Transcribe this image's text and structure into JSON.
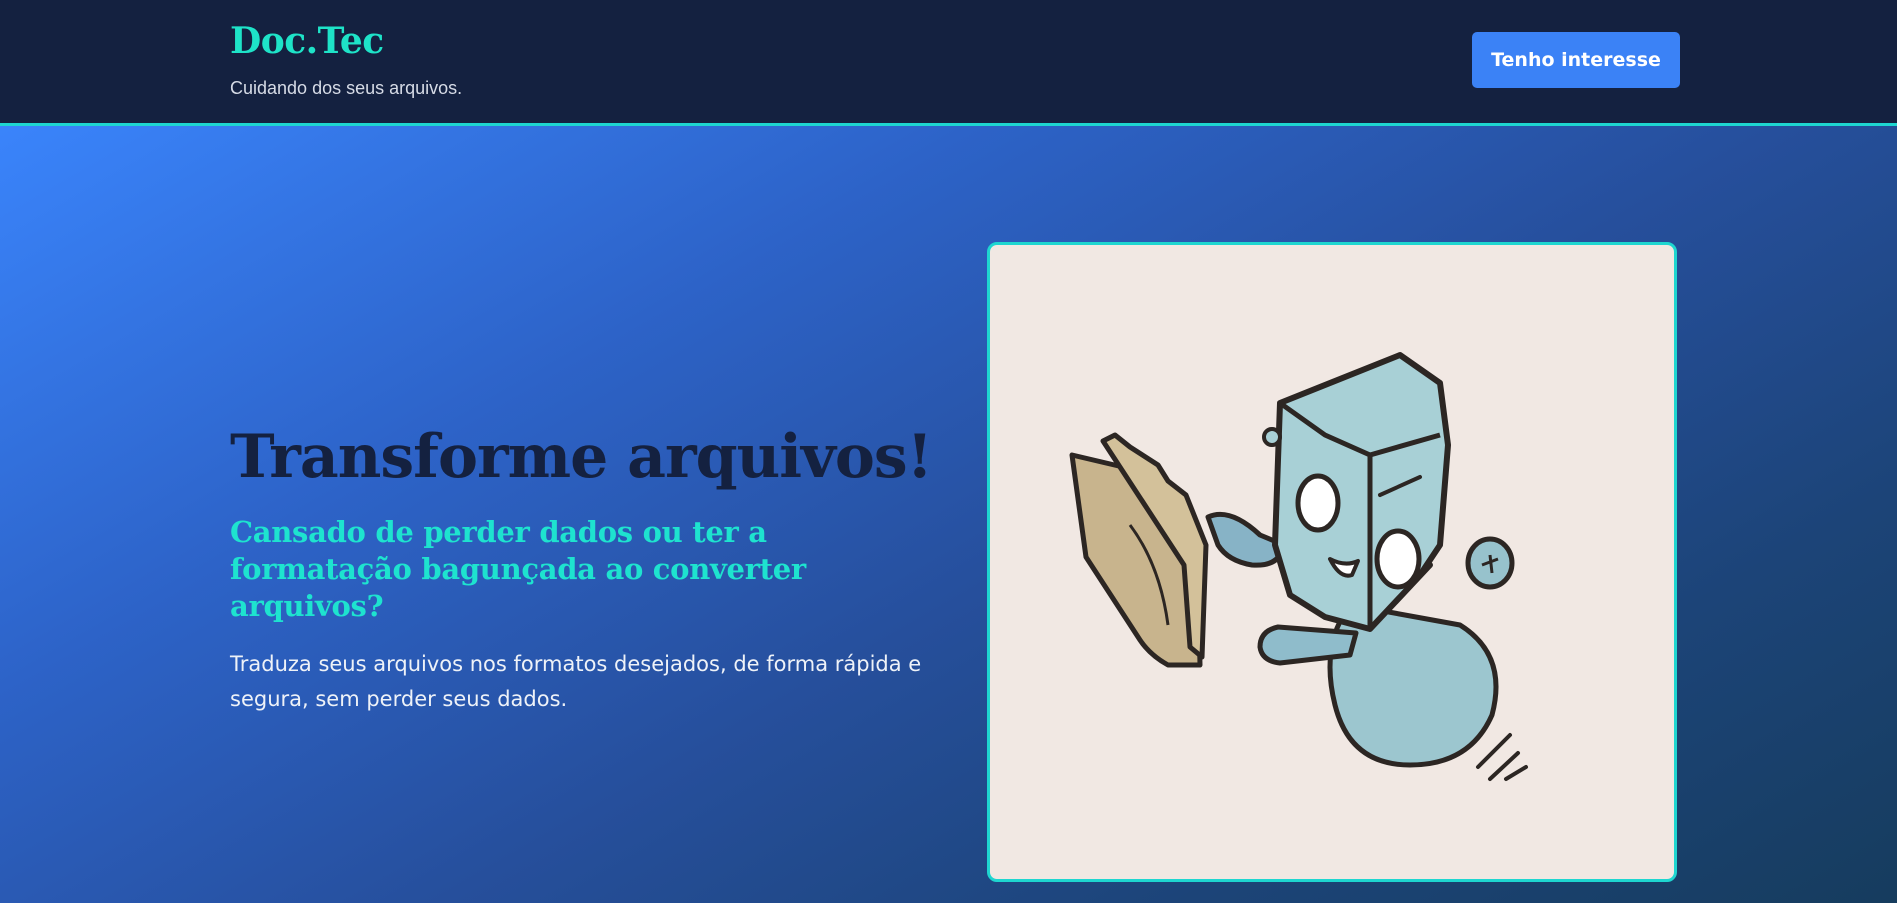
{
  "header": {
    "logo": "Doc.Tec",
    "tagline": "Cuidando dos seus arquivos.",
    "cta_label": "Tenho interesse"
  },
  "hero": {
    "headline": "Transforme arquivos!",
    "subheadline": "Cansado de perder dados ou ter a formatação bagunçada ao converter arquivos?",
    "description": "Traduza seus arquivos nos formatos desejados, de forma rápida e segura, sem perder seus dados.",
    "illustration": "robot-holding-folder-illustration"
  },
  "colors": {
    "header_bg": "#142140",
    "accent_teal": "#1ee3c8",
    "button_blue": "#3b82f6",
    "headline_navy": "#142140",
    "card_bg": "#f1e8e3"
  }
}
